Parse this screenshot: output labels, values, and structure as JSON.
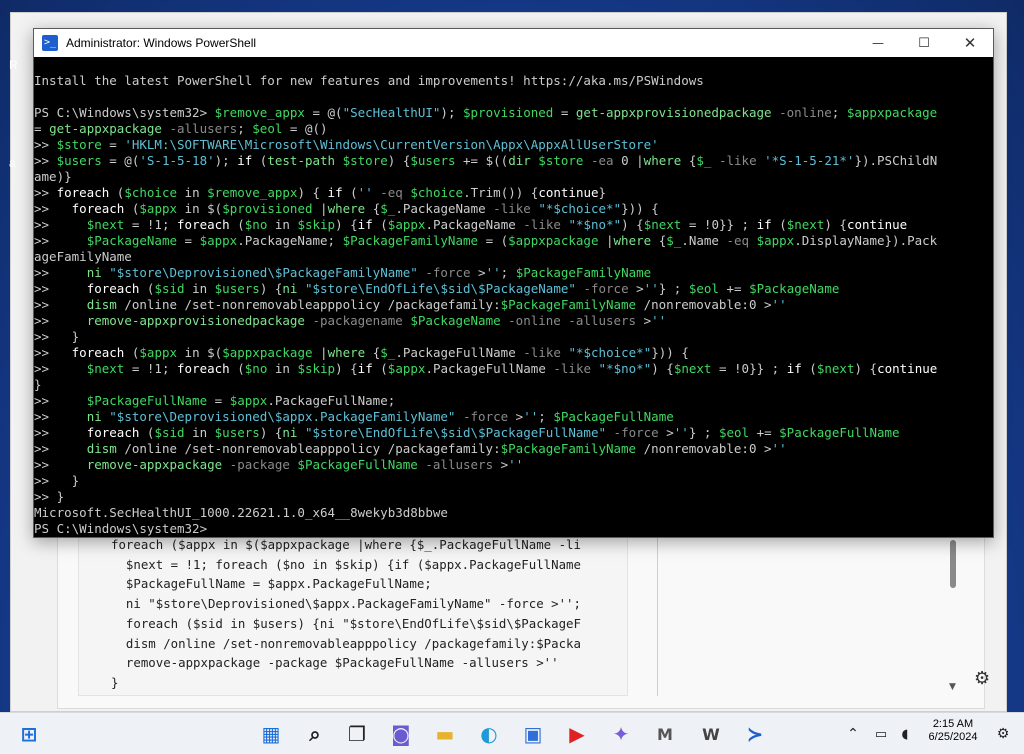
{
  "window": {
    "title": "Administrator: Windows PowerShell",
    "minimize_icon": "—",
    "maximize_icon": "☐",
    "close_icon": "✕"
  },
  "console": {
    "lines": [
      [
        [
          "w",
          "Install the latest PowerShell for new features and improvements! https://aka.ms/PSWindows"
        ]
      ],
      [
        [
          "w",
          ""
        ]
      ],
      [
        [
          "w",
          "PS C:\\Windows\\system32> "
        ],
        [
          "v",
          "$remove_appx"
        ],
        [
          "w",
          " = @("
        ],
        [
          "s",
          "\"SecHealthUI\""
        ],
        [
          "w",
          "); "
        ],
        [
          "v",
          "$provisioned"
        ],
        [
          "w",
          " = "
        ],
        [
          "c",
          "get-appxprovisionedpackage"
        ],
        [
          "g",
          " -online"
        ],
        [
          "w",
          "; "
        ],
        [
          "v",
          "$appxpackage"
        ]
      ],
      [
        [
          "w",
          "= "
        ],
        [
          "c",
          "get-appxpackage"
        ],
        [
          "g",
          " -allusers"
        ],
        [
          "w",
          "; "
        ],
        [
          "v",
          "$eol"
        ],
        [
          "w",
          " = @()"
        ]
      ],
      [
        [
          "w",
          ">> "
        ],
        [
          "v",
          "$store"
        ],
        [
          "w",
          " = "
        ],
        [
          "s",
          "'HKLM:\\SOFTWARE\\Microsoft\\Windows\\CurrentVersion\\Appx\\AppxAllUserStore'"
        ]
      ],
      [
        [
          "w",
          ">> "
        ],
        [
          "v",
          "$users"
        ],
        [
          "w",
          " = @("
        ],
        [
          "s",
          "'S-1-5-18'"
        ],
        [
          "w",
          "); "
        ],
        [
          "k",
          "if"
        ],
        [
          "w",
          " ("
        ],
        [
          "c",
          "test-path"
        ],
        [
          "w",
          " "
        ],
        [
          "v",
          "$store"
        ],
        [
          "w",
          ") {"
        ],
        [
          "v",
          "$users"
        ],
        [
          "w",
          " += $(("
        ],
        [
          "c",
          "dir"
        ],
        [
          "w",
          " "
        ],
        [
          "v",
          "$store"
        ],
        [
          "g",
          " -ea"
        ],
        [
          "w",
          " 0 |"
        ],
        [
          "c",
          "where"
        ],
        [
          "w",
          " {"
        ],
        [
          "v",
          "$_"
        ],
        [
          "g",
          " -like"
        ],
        [
          "w",
          " "
        ],
        [
          "s",
          "'*S-1-5-21*'"
        ],
        [
          "w",
          "}).PSChildN"
        ]
      ],
      [
        [
          "w",
          "ame)}"
        ]
      ],
      [
        [
          "w",
          ">> "
        ],
        [
          "k",
          "foreach"
        ],
        [
          "w",
          " ("
        ],
        [
          "v",
          "$choice"
        ],
        [
          "w",
          " in "
        ],
        [
          "v",
          "$remove_appx"
        ],
        [
          "w",
          ") { "
        ],
        [
          "k",
          "if"
        ],
        [
          "w",
          " ("
        ],
        [
          "s",
          "''"
        ],
        [
          "g",
          " -eq"
        ],
        [
          "w",
          " "
        ],
        [
          "v",
          "$choice"
        ],
        [
          "w",
          ".Trim()) {"
        ],
        [
          "k",
          "continue"
        ],
        [
          "w",
          "}"
        ]
      ],
      [
        [
          "w",
          ">>   "
        ],
        [
          "k",
          "foreach"
        ],
        [
          "w",
          " ("
        ],
        [
          "v",
          "$appx"
        ],
        [
          "w",
          " in $("
        ],
        [
          "v",
          "$provisioned"
        ],
        [
          "w",
          " |"
        ],
        [
          "c",
          "where"
        ],
        [
          "w",
          " {"
        ],
        [
          "v",
          "$_"
        ],
        [
          "w",
          ".PackageName"
        ],
        [
          "g",
          " -like"
        ],
        [
          "w",
          " "
        ],
        [
          "s",
          "\"*$choice*\""
        ],
        [
          "w",
          "})) {"
        ]
      ],
      [
        [
          "w",
          ">>     "
        ],
        [
          "v",
          "$next"
        ],
        [
          "w",
          " = !1; "
        ],
        [
          "k",
          "foreach"
        ],
        [
          "w",
          " ("
        ],
        [
          "v",
          "$no"
        ],
        [
          "w",
          " in "
        ],
        [
          "v",
          "$skip"
        ],
        [
          "w",
          ") {"
        ],
        [
          "k",
          "if"
        ],
        [
          "w",
          " ("
        ],
        [
          "v",
          "$appx"
        ],
        [
          "w",
          ".PackageName"
        ],
        [
          "g",
          " -like"
        ],
        [
          "w",
          " "
        ],
        [
          "s",
          "\"*$no*\""
        ],
        [
          "w",
          ") {"
        ],
        [
          "v",
          "$next"
        ],
        [
          "w",
          " = !0}} ; "
        ],
        [
          "k",
          "if"
        ],
        [
          "w",
          " ("
        ],
        [
          "v",
          "$next"
        ],
        [
          "w",
          ") {"
        ],
        [
          "k",
          "continue"
        ]
      ],
      [
        [
          "w",
          ">>     "
        ],
        [
          "v",
          "$PackageName"
        ],
        [
          "w",
          " = "
        ],
        [
          "v",
          "$appx"
        ],
        [
          "w",
          ".PackageName; "
        ],
        [
          "v",
          "$PackageFamilyName"
        ],
        [
          "w",
          " = ("
        ],
        [
          "v",
          "$appxpackage"
        ],
        [
          "w",
          " |"
        ],
        [
          "c",
          "where"
        ],
        [
          "w",
          " {"
        ],
        [
          "v",
          "$_"
        ],
        [
          "w",
          ".Name"
        ],
        [
          "g",
          " -eq"
        ],
        [
          "w",
          " "
        ],
        [
          "v",
          "$appx"
        ],
        [
          "w",
          ".DisplayName}).Pack"
        ]
      ],
      [
        [
          "w",
          "ageFamilyName"
        ]
      ],
      [
        [
          "w",
          ">>     "
        ],
        [
          "c",
          "ni"
        ],
        [
          "w",
          " "
        ],
        [
          "s",
          "\"$store\\Deprovisioned\\$PackageFamilyName\""
        ],
        [
          "g",
          " -force"
        ],
        [
          "w",
          " >"
        ],
        [
          "s",
          "''"
        ],
        [
          "w",
          "; "
        ],
        [
          "v",
          "$PackageFamilyName"
        ]
      ],
      [
        [
          "w",
          ">>     "
        ],
        [
          "k",
          "foreach"
        ],
        [
          "w",
          " ("
        ],
        [
          "v",
          "$sid"
        ],
        [
          "w",
          " in "
        ],
        [
          "v",
          "$users"
        ],
        [
          "w",
          ") {"
        ],
        [
          "c",
          "ni"
        ],
        [
          "w",
          " "
        ],
        [
          "s",
          "\"$store\\EndOfLife\\$sid\\$PackageName\""
        ],
        [
          "g",
          " -force"
        ],
        [
          "w",
          " >"
        ],
        [
          "s",
          "''"
        ],
        [
          "w",
          "} ; "
        ],
        [
          "v",
          "$eol"
        ],
        [
          "w",
          " += "
        ],
        [
          "v",
          "$PackageName"
        ]
      ],
      [
        [
          "w",
          ">>     "
        ],
        [
          "c",
          "dism"
        ],
        [
          "w",
          " /online /set-nonremovableapppolicy /packagefamily:"
        ],
        [
          "v",
          "$PackageFamilyName"
        ],
        [
          "w",
          " /nonremovable:0 >"
        ],
        [
          "s",
          "''"
        ]
      ],
      [
        [
          "w",
          ">>     "
        ],
        [
          "c",
          "remove-appxprovisionedpackage"
        ],
        [
          "g",
          " -packagename"
        ],
        [
          "w",
          " "
        ],
        [
          "v",
          "$PackageName"
        ],
        [
          "g",
          " -online -allusers"
        ],
        [
          "w",
          " >"
        ],
        [
          "s",
          "''"
        ]
      ],
      [
        [
          "w",
          ">>   }"
        ]
      ],
      [
        [
          "w",
          ">>   "
        ],
        [
          "k",
          "foreach"
        ],
        [
          "w",
          " ("
        ],
        [
          "v",
          "$appx"
        ],
        [
          "w",
          " in $("
        ],
        [
          "v",
          "$appxpackage"
        ],
        [
          "w",
          " |"
        ],
        [
          "c",
          "where"
        ],
        [
          "w",
          " {"
        ],
        [
          "v",
          "$_"
        ],
        [
          "w",
          ".PackageFullName"
        ],
        [
          "g",
          " -like"
        ],
        [
          "w",
          " "
        ],
        [
          "s",
          "\"*$choice*\""
        ],
        [
          "w",
          "})) {"
        ]
      ],
      [
        [
          "w",
          ">>     "
        ],
        [
          "v",
          "$next"
        ],
        [
          "w",
          " = !1; "
        ],
        [
          "k",
          "foreach"
        ],
        [
          "w",
          " ("
        ],
        [
          "v",
          "$no"
        ],
        [
          "w",
          " in "
        ],
        [
          "v",
          "$skip"
        ],
        [
          "w",
          ") {"
        ],
        [
          "k",
          "if"
        ],
        [
          "w",
          " ("
        ],
        [
          "v",
          "$appx"
        ],
        [
          "w",
          ".PackageFullName"
        ],
        [
          "g",
          " -like"
        ],
        [
          "w",
          " "
        ],
        [
          "s",
          "\"*$no*\""
        ],
        [
          "w",
          ") {"
        ],
        [
          "v",
          "$next"
        ],
        [
          "w",
          " = !0}} ; "
        ],
        [
          "k",
          "if"
        ],
        [
          "w",
          " ("
        ],
        [
          "v",
          "$next"
        ],
        [
          "w",
          ") {"
        ],
        [
          "k",
          "continue"
        ]
      ],
      [
        [
          "w",
          "}"
        ]
      ],
      [
        [
          "w",
          ">>     "
        ],
        [
          "v",
          "$PackageFullName"
        ],
        [
          "w",
          " = "
        ],
        [
          "v",
          "$appx"
        ],
        [
          "w",
          ".PackageFullName;"
        ]
      ],
      [
        [
          "w",
          ">>     "
        ],
        [
          "c",
          "ni"
        ],
        [
          "w",
          " "
        ],
        [
          "s",
          "\"$store\\Deprovisioned\\$appx.PackageFamilyName\""
        ],
        [
          "g",
          " -force"
        ],
        [
          "w",
          " >"
        ],
        [
          "s",
          "''"
        ],
        [
          "w",
          "; "
        ],
        [
          "v",
          "$PackageFullName"
        ]
      ],
      [
        [
          "w",
          ">>     "
        ],
        [
          "k",
          "foreach"
        ],
        [
          "w",
          " ("
        ],
        [
          "v",
          "$sid"
        ],
        [
          "w",
          " in "
        ],
        [
          "v",
          "$users"
        ],
        [
          "w",
          ") {"
        ],
        [
          "c",
          "ni"
        ],
        [
          "w",
          " "
        ],
        [
          "s",
          "\"$store\\EndOfLife\\$sid\\$PackageFullName\""
        ],
        [
          "g",
          " -force"
        ],
        [
          "w",
          " >"
        ],
        [
          "s",
          "''"
        ],
        [
          "w",
          "} ; "
        ],
        [
          "v",
          "$eol"
        ],
        [
          "w",
          " += "
        ],
        [
          "v",
          "$PackageFullName"
        ]
      ],
      [
        [
          "w",
          ">>     "
        ],
        [
          "c",
          "dism"
        ],
        [
          "w",
          " /online /set-nonremovableapppolicy /packagefamily:"
        ],
        [
          "v",
          "$PackageFamilyName"
        ],
        [
          "w",
          " /nonremovable:0 >"
        ],
        [
          "s",
          "''"
        ]
      ],
      [
        [
          "w",
          ">>     "
        ],
        [
          "c",
          "remove-appxpackage"
        ],
        [
          "g",
          " -package"
        ],
        [
          "w",
          " "
        ],
        [
          "v",
          "$PackageFullName"
        ],
        [
          "g",
          " -allusers"
        ],
        [
          "w",
          " >"
        ],
        [
          "s",
          "''"
        ]
      ],
      [
        [
          "w",
          ">>   }"
        ]
      ],
      [
        [
          "w",
          ">> }"
        ]
      ],
      [
        [
          "w",
          "Microsoft.SecHealthUI_1000.22621.1.0_x64__8wekyb3d8bbwe"
        ]
      ],
      [
        [
          "w",
          "PS C:\\Windows\\system32>"
        ]
      ]
    ]
  },
  "background": {
    "code_lines": [
      "foreach ($appx in $($appxpackage |where {$_.PackageFullName -li",
      "  $next = !1; foreach ($no in $skip) {if ($appx.PackageFullName",
      "  $PackageFullName = $appx.PackageFullName;",
      "  ni \"$store\\Deprovisioned\\$appx.PackageFamilyName\" -force >'';",
      "  foreach ($sid in $users) {ni \"$store\\EndOfLife\\$sid\\$PackageF",
      "  dism /online /set-nonremovableapppolicy /packagefamily:$Packa",
      "  remove-appxpackage -package $PackageFullName -allusers >''",
      "}"
    ],
    "edge_letter_top": "R",
    "edge_letter_mid": "a"
  },
  "taskbar": {
    "icons": [
      {
        "name": "start-icon",
        "glyph": "⊞",
        "color": "#1e6fd9"
      },
      {
        "name": "windows-start-icon",
        "glyph": "▦",
        "color": "#1e6fd9"
      },
      {
        "name": "search-icon",
        "glyph": "⌕",
        "color": "#222222"
      },
      {
        "name": "task-view-icon",
        "glyph": "❐",
        "color": "#222222"
      },
      {
        "name": "teams-chat-icon",
        "glyph": "◙",
        "color": "#6b5bd1"
      },
      {
        "name": "file-explorer-icon",
        "glyph": "▬",
        "color": "#e7b32e"
      },
      {
        "name": "edge-icon",
        "glyph": "◐",
        "color": "#1f9ad6"
      },
      {
        "name": "store-icon",
        "glyph": "▣",
        "color": "#2f6fd9"
      },
      {
        "name": "youtube-icon",
        "glyph": "▶",
        "color": "#e02222"
      },
      {
        "name": "copilot-icon",
        "glyph": "✦",
        "color": "#7a5bd8"
      },
      {
        "name": "m-app-icon",
        "glyph": "M",
        "color": "#555555"
      },
      {
        "name": "word-icon",
        "glyph": "W",
        "color": "#444444"
      },
      {
        "name": "powershell-taskbar-icon",
        "glyph": "≻",
        "color": "#1f5ecf"
      }
    ],
    "tray": {
      "chevron_icon": "⌃",
      "network_icon": "▭",
      "volume_icon": "◖",
      "notification_icon": "⚙",
      "time": "2:15 AM",
      "date": "6/25/2024"
    }
  }
}
